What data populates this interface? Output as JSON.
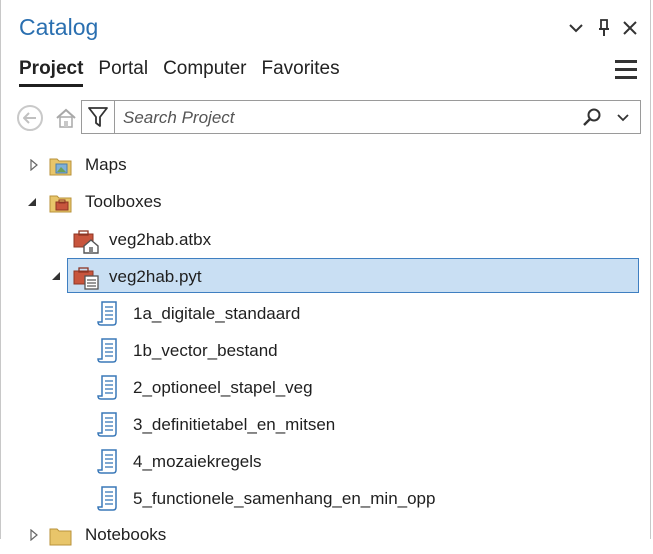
{
  "pane": {
    "title": "Catalog",
    "tabs": [
      {
        "label": "Project",
        "active": true
      },
      {
        "label": "Portal",
        "active": false
      },
      {
        "label": "Computer",
        "active": false
      },
      {
        "label": "Favorites",
        "active": false
      }
    ]
  },
  "search": {
    "placeholder": "Search Project",
    "value": ""
  },
  "tree": {
    "maps": "Maps",
    "toolboxes": "Toolboxes",
    "atbx": "veg2hab.atbx",
    "pyt": "veg2hab.pyt",
    "tools": [
      "1a_digitale_standaard",
      "1b_vector_bestand",
      "2_optioneel_stapel_veg",
      "3_definitietabel_en_mitsen",
      "4_mozaiekregels",
      "5_functionele_samenhang_en_min_opp"
    ],
    "notebooks": "Notebooks"
  },
  "colors": {
    "accent": "#2a6fb0",
    "selection": "#c9dff3",
    "selection_border": "#3f7fc1"
  },
  "icons": [
    "chevron-down-icon",
    "pin-icon",
    "close-icon",
    "hamburger-menu-icon",
    "back-icon",
    "home-icon",
    "filter-icon",
    "search-icon",
    "dropdown-icon",
    "folder-icon",
    "toolbox-icon",
    "script-icon"
  ]
}
